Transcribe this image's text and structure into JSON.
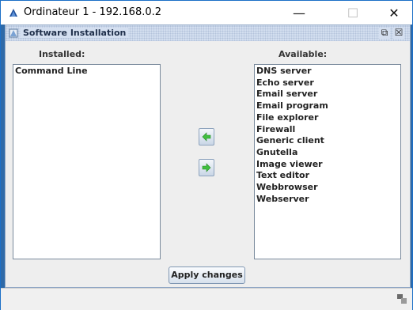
{
  "window": {
    "title": "Ordinateur 1 - 192.168.0.2",
    "minimize_glyph": "—",
    "maximize_glyph": "☐",
    "close_glyph": "✕"
  },
  "internal_frame": {
    "title": "Software Installation",
    "restore_glyph": "⧉",
    "close_glyph": "☒"
  },
  "installed": {
    "label": "Installed:",
    "items": [
      "Command Line"
    ]
  },
  "available": {
    "label": "Available:",
    "items": [
      "DNS server",
      "Echo server",
      "Email server",
      "Email program",
      "File explorer",
      "Firewall",
      "Generic client",
      "Gnutella",
      "Image viewer",
      "Text editor",
      "Webbrowser",
      "Webserver"
    ]
  },
  "buttons": {
    "apply_label": "Apply changes",
    "move_left_icon": "arrow-left-icon",
    "move_right_icon": "arrow-right-icon"
  },
  "colors": {
    "accent_blue": "#1b6fc7",
    "arrow_green": "#3fbf3f",
    "frame_bg": "#eeeeee"
  }
}
